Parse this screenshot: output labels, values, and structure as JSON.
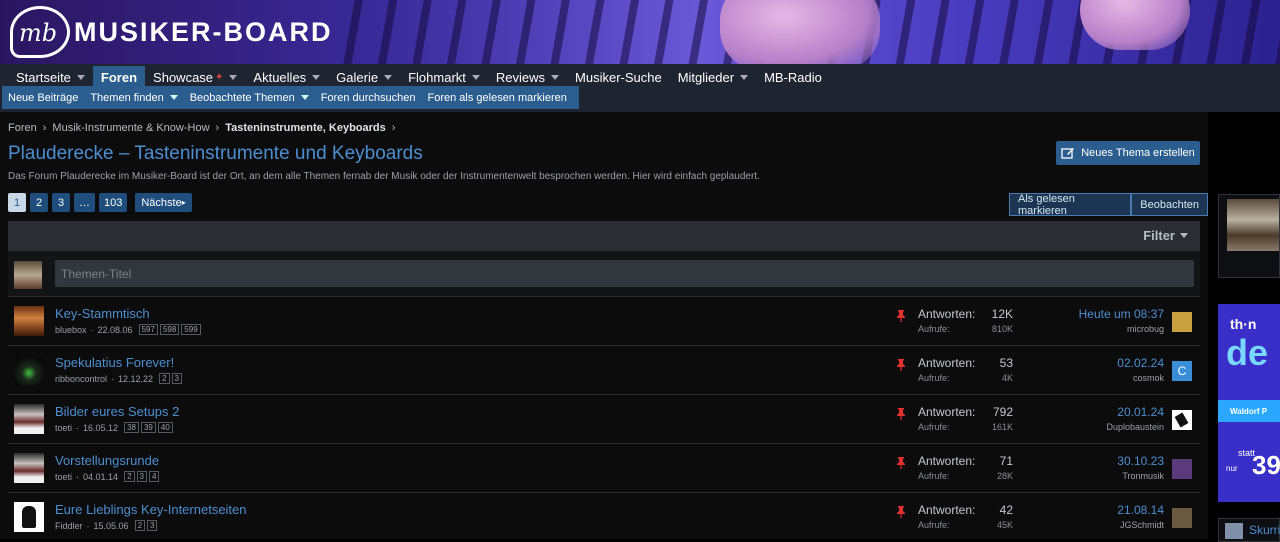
{
  "site": {
    "logo_mark": "mb",
    "name": "MUSIKER-BOARD"
  },
  "nav": {
    "items": [
      {
        "label": "Startseite",
        "caret": true
      },
      {
        "label": "Foren",
        "active": true
      },
      {
        "label": "Showcase",
        "caret": true,
        "sparkle": true
      },
      {
        "label": "Aktuelles",
        "caret": true
      },
      {
        "label": "Galerie",
        "caret": true
      },
      {
        "label": "Flohmarkt",
        "caret": true
      },
      {
        "label": "Reviews",
        "caret": true
      },
      {
        "label": "Musiker-Suche"
      },
      {
        "label": "Mitglieder",
        "caret": true
      },
      {
        "label": "MB-Radio"
      }
    ],
    "sub_items": [
      {
        "label": "Neue Beiträge"
      },
      {
        "label": "Themen finden",
        "caret": true
      },
      {
        "label": "Beobachtete Themen",
        "caret": true
      },
      {
        "label": "Foren durchsuchen"
      },
      {
        "label": "Foren als gelesen markieren"
      }
    ]
  },
  "breadcrumb": [
    "Foren",
    "Musik-Instrumente & Know-How",
    "Tasteninstrumente, Keyboards"
  ],
  "page": {
    "title": "Plauderecke – Tasteninstrumente und Keyboards",
    "description": "Das Forum Plauderecke im Musiker-Board ist der Ort, an dem alle Themen fernab der Musik oder der Instrumentenwelt besprochen werden. Hier wird einfach geplaudert.",
    "new_thread_button": "Neues Thema erstellen",
    "mark_read_button": "Als gelesen markieren",
    "watch_button": "Beobachten"
  },
  "pagination": {
    "pages": [
      "1",
      "2",
      "3",
      "…",
      "103"
    ],
    "current": "1",
    "next_label": "Nächste"
  },
  "filter": {
    "label": "Filter",
    "title_placeholder": "Themen-Titel"
  },
  "threads": [
    {
      "title": "Key-Stammtisch",
      "author": "bluebox",
      "date": "22.08.06",
      "pages": [
        "597",
        "598",
        "599"
      ],
      "replies_label": "Antworten:",
      "replies": "12K",
      "views_label": "Aufrufe:",
      "views": "810K",
      "last_date": "Heute um 08:37",
      "last_user": "microbug",
      "avatar_color": "#8a4a20",
      "last_avatar_color": "#c8a040"
    },
    {
      "title": "Spekulatius Forever!",
      "author": "ribboncontrol",
      "date": "12.12.22",
      "pages": [
        "2",
        "3"
      ],
      "replies_label": "Antworten:",
      "replies": "53",
      "views_label": "Aufrufe:",
      "views": "4K",
      "last_date": "02.02.24",
      "last_user": "cosmok",
      "avatar_color": "#1a2a1a",
      "last_avatar_color": "#3a8ed8",
      "last_avatar_letter": "C"
    },
    {
      "title": "Bilder eures Setups 2",
      "author": "toeti",
      "date": "16.05.12",
      "pages": [
        "38",
        "39",
        "40"
      ],
      "replies_label": "Antworten:",
      "replies": "792",
      "views_label": "Aufrufe:",
      "views": "161K",
      "last_date": "20.01.24",
      "last_user": "Duplobaustein",
      "avatar_color": "#6a3a3a",
      "last_avatar_color": "#ffffff"
    },
    {
      "title": "Vorstellungsrunde",
      "author": "toeti",
      "date": "04.01.14",
      "pages": [
        "2",
        "3",
        "4"
      ],
      "replies_label": "Antworten:",
      "replies": "71",
      "views_label": "Aufrufe:",
      "views": "28K",
      "last_date": "30.10.23",
      "last_user": "Tronmusik",
      "avatar_color": "#6a3a3a",
      "last_avatar_color": "#5a3a7a"
    },
    {
      "title": "Eure Lieblings Key-Internetseiten",
      "author": "Fiddler",
      "date": "15.05.06",
      "pages": [
        "2",
        "3"
      ],
      "replies_label": "Antworten:",
      "replies": "42",
      "views_label": "Aufrufe:",
      "views": "45K",
      "last_date": "21.08.14",
      "last_user": "JGSchmidt",
      "avatar_color": "#ffffff",
      "last_avatar_color": "#6a5a40"
    }
  ],
  "sidebar": {
    "ad": {
      "brand": "th·n",
      "big": "de",
      "band": "Waldorf P",
      "price_prefix": "statt",
      "price_label": "nur",
      "price": "39"
    },
    "member": {
      "name": "Skurri"
    }
  },
  "colors": {
    "accent": "#2c5d8f",
    "link": "#4d8ed0",
    "pin": "#e03030"
  }
}
